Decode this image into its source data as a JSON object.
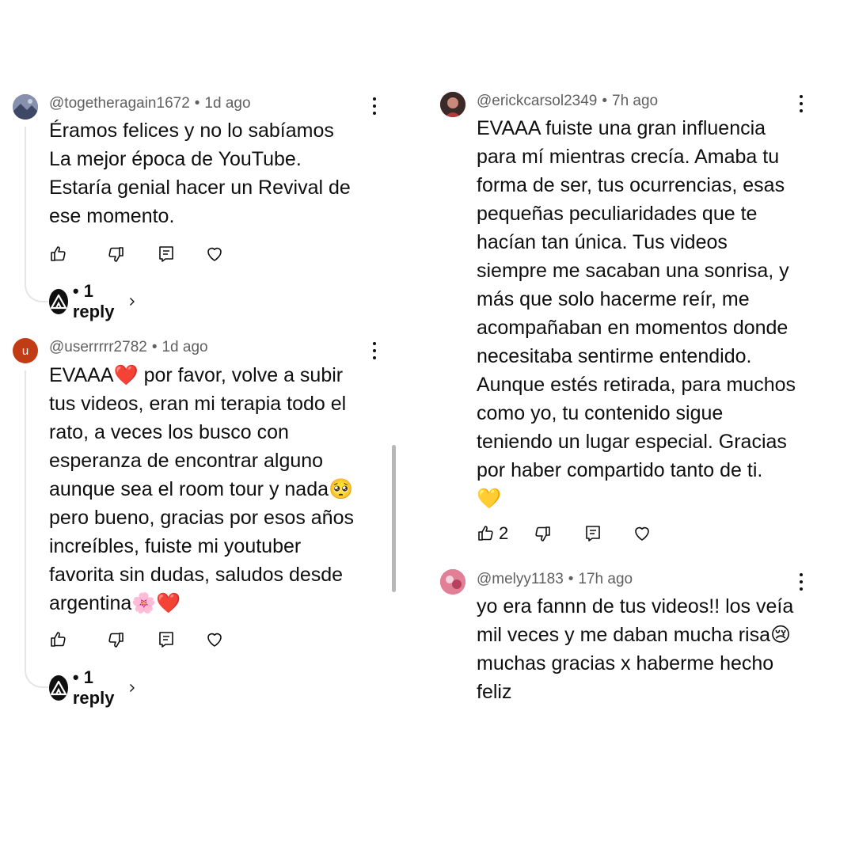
{
  "comments": [
    {
      "handle": "@togetheragain1672",
      "time": "1d ago",
      "text": "Éramos felices y no lo sabíamos\nLa mejor época de YouTube.\nEstaría genial hacer un Revival de\nese momento.",
      "likes": "",
      "replies": "• 1 reply",
      "avatar": {
        "color": "#6d7a9c",
        "letter": ""
      }
    },
    {
      "handle": "@userrrrr2782",
      "time": "1d ago",
      "text": "EVAAA❤️ por favor, volve a subir\ntus videos, eran mi terapia todo el\nrato, a veces los busco con\nesperanza de encontrar alguno\naunque sea el room tour y nada🥺\npero bueno, gracias por esos años\nincreíbles, fuiste mi youtuber\nfavorita sin dudas, saludos desde\nargentina🌸❤️",
      "likes": "",
      "replies": "• 1 reply",
      "avatar": {
        "color": "#c13b14",
        "letter": "u"
      }
    },
    {
      "handle": "@erickcarsol2349",
      "time": "7h ago",
      "text": "EVAAA fuiste una gran influencia\npara mí mientras crecía. Amaba tu\nforma de ser, tus ocurrencias, esas\npequeñas peculiaridades que te\nhacían tan única. Tus videos\nsiempre me sacaban una sonrisa, y\nmás que solo hacerme reír, me\nacompañaban en momentos donde\nnecesitaba sentirme entendido.\nAunque estés retirada, para muchos\ncomo yo, tu contenido sigue\nteniendo un lugar especial. Gracias\npor haber compartido tanto de ti.\n💛",
      "likes": "2",
      "replies": "",
      "avatar": {
        "color": "#5a3c34",
        "letter": ""
      }
    },
    {
      "handle": "@melyy1183",
      "time": "17h ago",
      "text": "yo era fannn de tus videos!! los veía\nmil veces y me daban mucha risa😢\nmuchas gracias x haberme hecho\nfeliz",
      "likes": "",
      "replies": "",
      "avatar": {
        "color": "#d45a7a",
        "letter": ""
      }
    }
  ],
  "icons": {
    "like": "thumb-up-icon",
    "dislike": "thumb-down-icon",
    "reply": "comment-icon",
    "heart": "heart-icon",
    "more": "kebab-menu-icon",
    "reply_avatar": "channel-logo-icon",
    "chevron": "chevron-right-icon"
  }
}
